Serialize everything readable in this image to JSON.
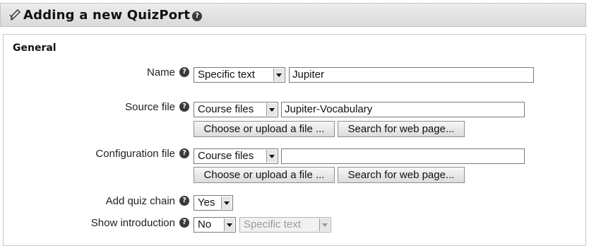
{
  "header": {
    "title": "Adding a new QuizPort"
  },
  "section": {
    "legend": "General"
  },
  "help_glyph": "?",
  "rows": {
    "name": {
      "label": "Name",
      "select_value": "Specific text",
      "input_value": "Jupiter"
    },
    "source_file": {
      "label": "Source file",
      "select_value": "Course files",
      "input_value": "Jupiter-Vocabulary",
      "choose_button": "Choose or upload a file ...",
      "search_button": "Search for web page..."
    },
    "config_file": {
      "label": "Configuration file",
      "select_value": "Course files",
      "input_value": "",
      "choose_button": "Choose or upload a file ...",
      "search_button": "Search for web page..."
    },
    "quiz_chain": {
      "label": "Add quiz chain",
      "select_value": "Yes"
    },
    "show_intro": {
      "label": "Show introduction",
      "select_value": "No",
      "secondary_select_value": "Specific text"
    }
  },
  "icons": {
    "header_icon": "edit-pencil-icon",
    "help_icon": "help-icon"
  }
}
